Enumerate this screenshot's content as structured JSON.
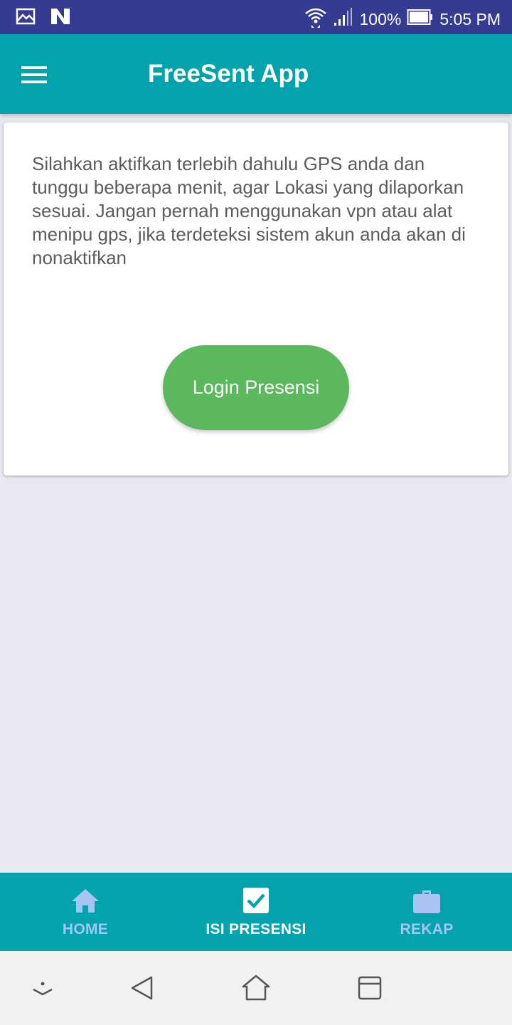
{
  "status_bar": {
    "battery_percent": "100%",
    "time": "5:05 PM",
    "icons": [
      "gallery-icon",
      "n-logo-icon",
      "wifi-icon",
      "signal-icon",
      "battery-icon"
    ]
  },
  "app_bar": {
    "title": "FreeSent App",
    "menu_icon": "hamburger-menu-icon",
    "color": "#03a3ad"
  },
  "card": {
    "message": "Silahkan aktifkan terlebih dahulu GPS anda dan tunggu beberapa menit, agar Lokasi yang dilaporkan sesuai. Jangan pernah menggunakan vpn atau alat menipu gps, jika terdeteksi sistem akun anda akan di nonaktifkan",
    "login_button": "Login Presensi",
    "button_color": "#5cb85c"
  },
  "bottom_nav": {
    "items": [
      {
        "label": "HOME",
        "icon": "home-icon",
        "active": false
      },
      {
        "label": "ISI PRESENSI",
        "icon": "checkbox-icon",
        "active": true
      },
      {
        "label": "REKAP",
        "icon": "briefcase-icon",
        "active": false
      }
    ]
  },
  "system_nav": {
    "icons": [
      "collapse-icon",
      "back-icon",
      "home-icon",
      "recents-icon"
    ]
  }
}
